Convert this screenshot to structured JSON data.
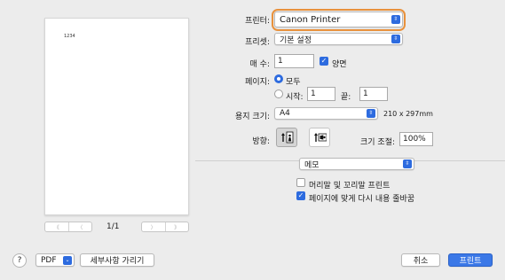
{
  "preview": {
    "page_text": "1234",
    "page_indicator": "1/1",
    "nav": {
      "first": "《",
      "prev": "〈",
      "next": "〉",
      "last": "》"
    }
  },
  "printer": {
    "label": "프린터:",
    "value": "Canon Printer"
  },
  "preset": {
    "label": "프리셋:",
    "value": "기본 설정"
  },
  "copies": {
    "label": "매 수:",
    "value": "1",
    "two_sided_label": "양면",
    "two_sided_checked": true
  },
  "pages": {
    "label": "페이지:",
    "all_label": "모두",
    "from_label": "시작:",
    "from_value": "1",
    "to_label": "끝:",
    "to_value": "1",
    "selected": "all"
  },
  "paper_size": {
    "label": "용지 크기:",
    "value": "A4",
    "dimensions": "210 x 297mm"
  },
  "orientation": {
    "label": "방향:",
    "selected": "portrait"
  },
  "scale": {
    "label": "크기 조절:",
    "value": "100%"
  },
  "section": {
    "value": "메모"
  },
  "options": [
    {
      "label": "머리말 및 꼬리말 프린트",
      "checked": false
    },
    {
      "label": "페이지에 맞게 다시 내용 줄바꿈",
      "checked": true
    }
  ],
  "footer": {
    "help": "?",
    "pdf": "PDF",
    "pdf_chevron": "⌄",
    "hide_details": "세부사항 가리기",
    "cancel": "취소",
    "print": "프린트"
  },
  "colors": {
    "accent": "#2d6bdf",
    "focus_ring": "#e8913c"
  }
}
